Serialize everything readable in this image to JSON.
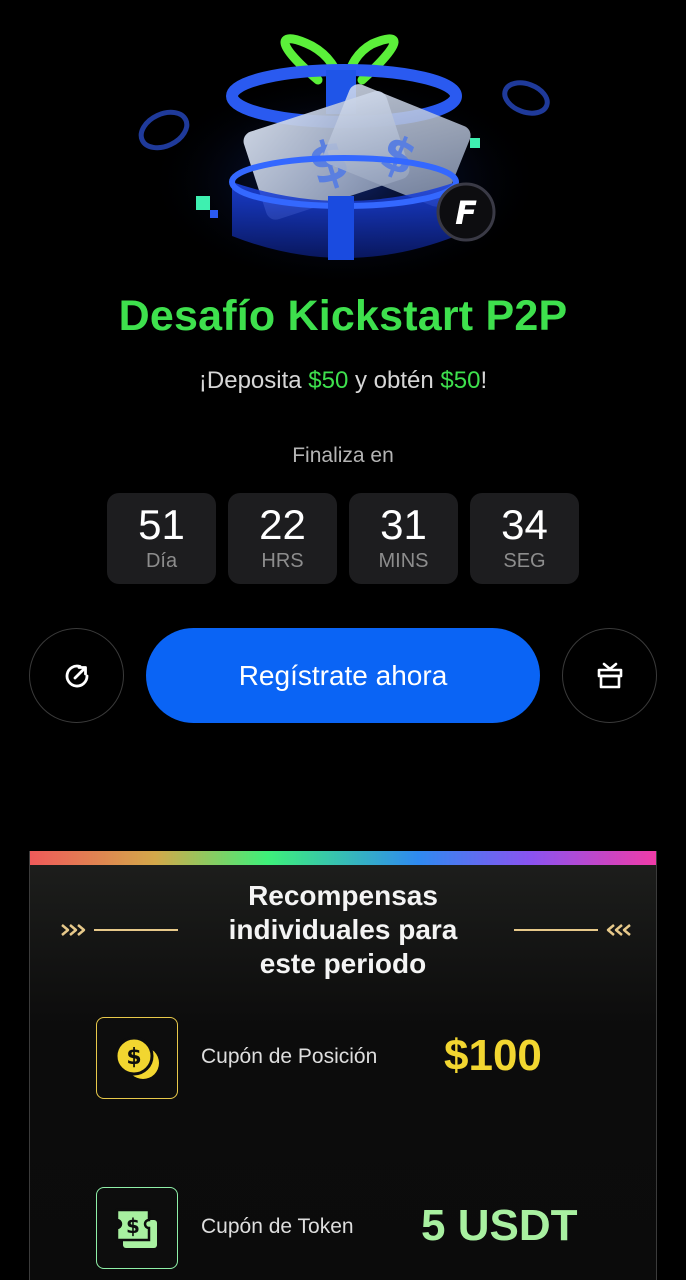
{
  "hero": {
    "icon": "gift-box-with-dollar-coupons-illustration",
    "coin_letter": "F"
  },
  "title": "Desafío Kickstart P2P",
  "subtitle": {
    "part1": "¡Deposita ",
    "amount1": "$50",
    "part2": " y obtén ",
    "amount2": "$50",
    "part3": "!"
  },
  "countdown": {
    "label": "Finaliza en",
    "items": [
      {
        "value": "51",
        "unit": "Día"
      },
      {
        "value": "22",
        "unit": "HRS"
      },
      {
        "value": "31",
        "unit": "MINS"
      },
      {
        "value": "34",
        "unit": "SEG"
      }
    ]
  },
  "actions": {
    "left_icon": "share-icon",
    "cta_label": "Regístrate ahora",
    "right_icon": "gift-icon"
  },
  "rewards": {
    "title_lines": [
      "Recompensas",
      "individuales para",
      "este periodo"
    ],
    "items": [
      {
        "icon": "coin-dollar-icon",
        "label": "Cupón de Posición",
        "value": "$100"
      },
      {
        "icon": "ticket-dollar-icon",
        "label": "Cupón de Token",
        "value": "5 USDT"
      }
    ]
  },
  "colors": {
    "accent_green": "#3ee04d",
    "cta_blue": "#0a64f5",
    "gold": "#f2d630",
    "mint": "#a8f0a0"
  }
}
